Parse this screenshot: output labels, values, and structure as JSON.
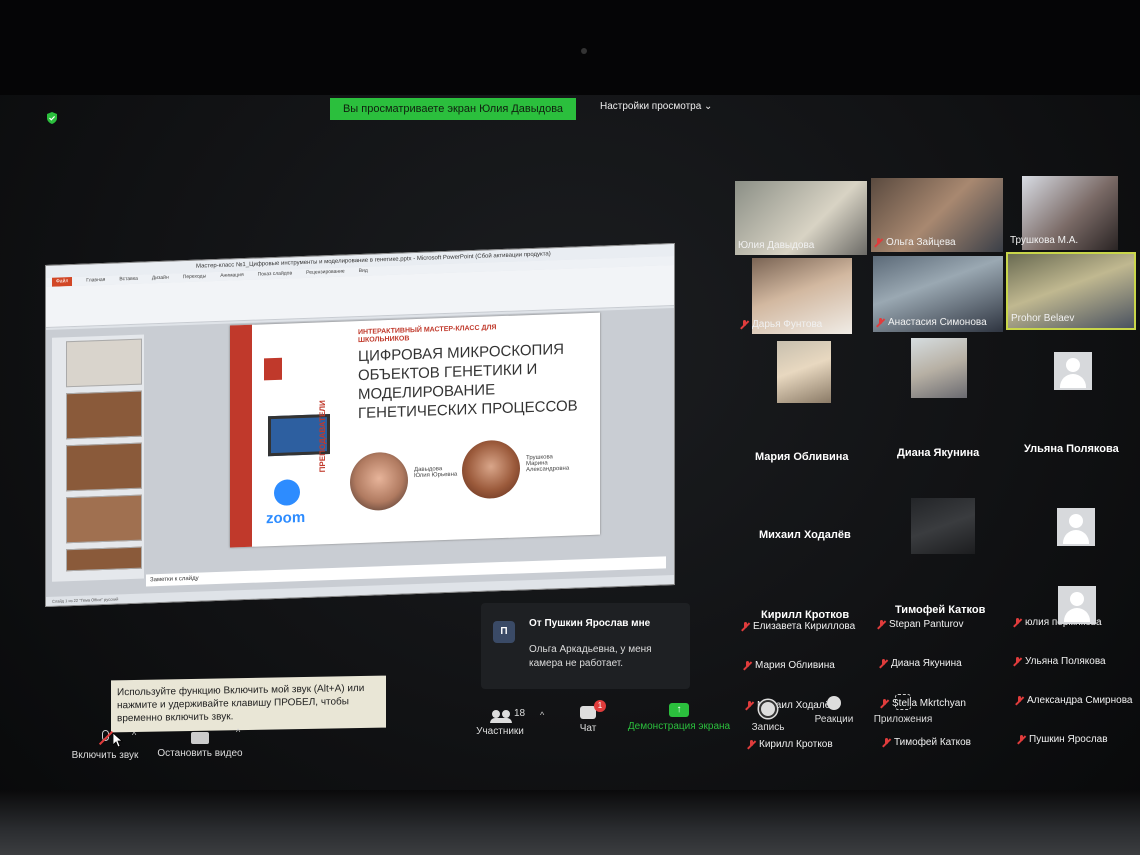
{
  "meeting": {
    "share_banner": "Вы просматриваете экран Юлия Давыдова",
    "view_settings": "Настройки просмотра ⌄"
  },
  "presentation": {
    "window_title": "Мастер-класс №1_Цифровые инструменты и моделирование в генетике.pptx - Microsoft PowerPoint (Сбой активации продукта)",
    "ribbon_tabs": [
      "Файл",
      "Главная",
      "Вставка",
      "Дизайн",
      "Переходы",
      "Анимация",
      "Показ слайдов",
      "Рецензирование",
      "Вид"
    ],
    "slide_subtitle": "ИНТЕРАКТИВНЫЙ МАСТЕР-КЛАСС ДЛЯ ШКОЛЬНИКОВ",
    "slide_title": "ЦИФРОВАЯ МИКРОСКОПИЯ ОБЪЕКТОВ ГЕНЕТИКИ И МОДЕЛИРОВАНИЕ ГЕНЕТИЧЕСКИХ ПРОЦЕССОВ",
    "slide_teachers_label": "ПРЕПОДАВАТЕЛИ",
    "slide_zoom_word": "zoom",
    "teacher1": "Давыдова Юлия Юрьевна",
    "teacher2": "Трушкова Марина Александровна",
    "notes_placeholder": "Заметки к слайду",
    "status_bar": "Слайд 1 из 22   \"Тема Office\"   русский"
  },
  "gallery": {
    "video_tiles": [
      {
        "name": "Юлия Давыдова",
        "muted": false
      },
      {
        "name": "Ольга Зайцева",
        "muted": true
      },
      {
        "name": "Трушкова М.А.",
        "muted": false
      },
      {
        "name": "Дарья Фунтова",
        "muted": true
      },
      {
        "name": "Анастасия Симонова",
        "muted": true
      },
      {
        "name": "Prohor Belaev",
        "muted": false
      },
      {
        "name": "Елизавета Кириллова",
        "muted": true
      },
      {
        "name": "Stepan Panturov",
        "muted": true
      },
      {
        "name": "юлия пермякова",
        "muted": true
      },
      {
        "name": "Мария Обливина",
        "muted": true
      },
      {
        "name": "Диана Якунина",
        "muted": true
      },
      {
        "name": "Ульяна Полякова",
        "muted": true
      },
      {
        "name": "Михаил Ходалёв",
        "muted": true
      },
      {
        "name": "Stella Mkrtchyan",
        "muted": true
      },
      {
        "name": "Александра Смирнова",
        "muted": true
      },
      {
        "name": "Кирилл Кротков",
        "muted": true
      },
      {
        "name": "Тимофей Катков",
        "muted": true
      },
      {
        "name": "Пушкин Ярослав",
        "muted": true
      }
    ],
    "big_names": [
      "Мария Обливина",
      "Диана Якунина",
      "Ульяна Полякова",
      "Михаил Ходалёв",
      "Кирилл Кротков",
      "Тимофей Катков"
    ]
  },
  "chat_popup": {
    "avatar_letter": "П",
    "from": "От Пушкин Ярослав мне",
    "message": "Ольга Аркадьевна, у меня камера не работает."
  },
  "tooltip": {
    "text": "Используйте функцию Включить мой звук (Alt+A) или нажмите и удерживайте клавишу ПРОБЕЛ, чтобы временно включить звук."
  },
  "toolbar": {
    "unmute": "Включить звук",
    "stop_video": "Остановить видео",
    "participants": "Участники",
    "participants_count": "18",
    "chat": "Чат",
    "chat_badge": "1",
    "share_screen": "Демонстрация экрана",
    "record": "Запись",
    "reactions": "Реакции",
    "apps": "Приложения"
  },
  "colors": {
    "share_green": "#2bbf3d",
    "mute_red": "#e03c3c",
    "slide_red": "#c0392b",
    "zoom_blue": "#2d8cff"
  }
}
